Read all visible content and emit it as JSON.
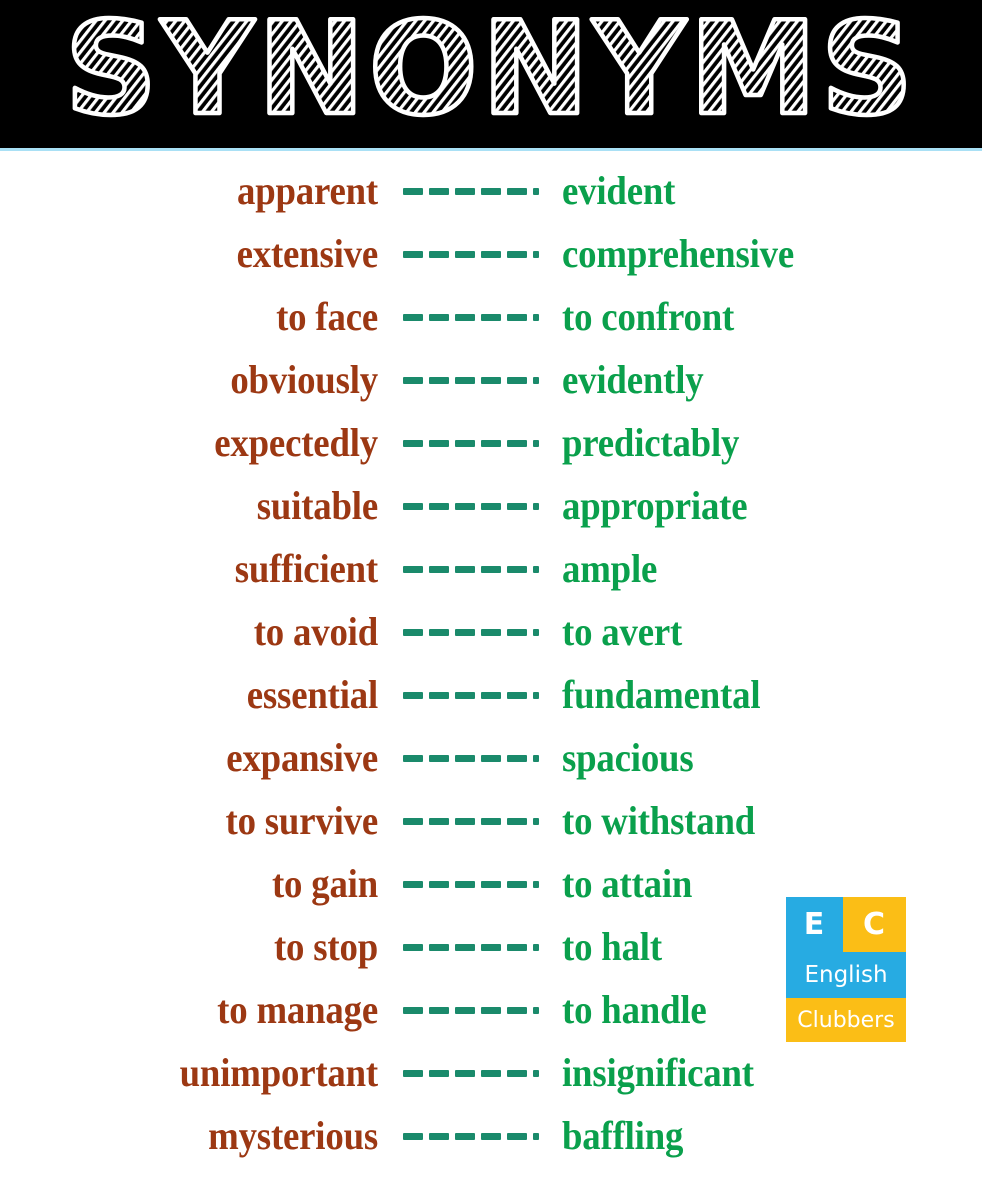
{
  "header": {
    "title": "SYNONYMS",
    "background_color": "#000000",
    "title_color": "#ffffff",
    "rule_color": "#a9e0f5"
  },
  "colors": {
    "left_word": "#9c3813",
    "right_word": "#0aa04c",
    "dash": "#1a8a6b",
    "page_background": "#ffffff",
    "logo_blue": "#27ABE2",
    "logo_yellow": "#FBBE16"
  },
  "separator": {
    "glyph": "------",
    "dash_count": 6
  },
  "pairs": [
    {
      "left": "apparent",
      "right": "evident"
    },
    {
      "left": "extensive",
      "right": "comprehensive"
    },
    {
      "left": "to face",
      "right": "to confront"
    },
    {
      "left": "obviously",
      "right": "evidently"
    },
    {
      "left": "expectedly",
      "right": "predictably"
    },
    {
      "left": "suitable",
      "right": "appropriate"
    },
    {
      "left": "sufficient",
      "right": "ample"
    },
    {
      "left": "to avoid",
      "right": "to avert"
    },
    {
      "left": "essential",
      "right": "fundamental"
    },
    {
      "left": "expansive",
      "right": "spacious"
    },
    {
      "left": "to survive",
      "right": "to withstand"
    },
    {
      "left": "to gain",
      "right": "to attain"
    },
    {
      "left": "to stop",
      "right": "to halt"
    },
    {
      "left": "to manage",
      "right": "to handle"
    },
    {
      "left": "unimportant",
      "right": "insignificant"
    },
    {
      "left": "mysterious",
      "right": "baffling"
    }
  ],
  "logo": {
    "letter_e": "E",
    "letter_c": "C",
    "line_english": "English",
    "line_clubbers": "Clubbers"
  }
}
